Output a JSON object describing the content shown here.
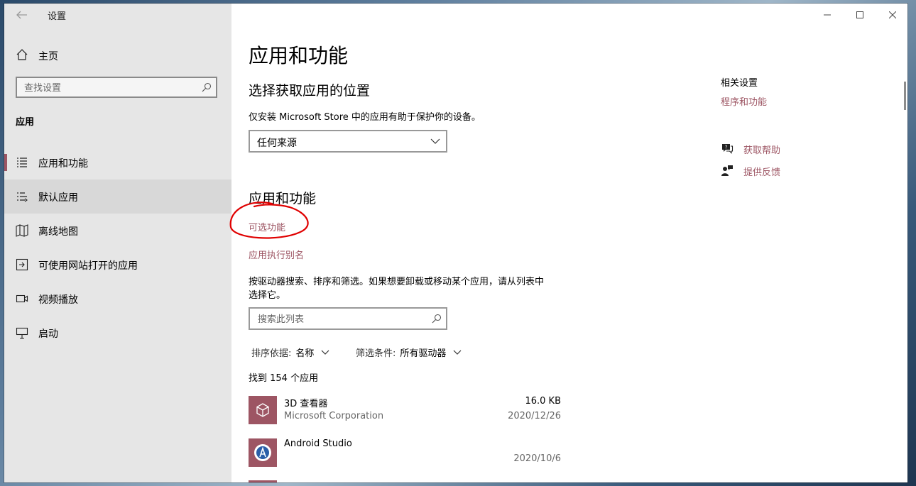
{
  "window": {
    "title": "设置",
    "controls": [
      "minimize-icon",
      "maximize-icon",
      "close-icon"
    ]
  },
  "nav": {
    "home_label": "主页",
    "search_placeholder": "查找设置",
    "section_header": "应用",
    "items": [
      {
        "label": "应用和功能",
        "icon": "apps-list-icon",
        "selected": false,
        "active": true
      },
      {
        "label": "默认应用",
        "icon": "default-apps-icon",
        "selected": true,
        "active": false
      },
      {
        "label": "离线地图",
        "icon": "map-icon",
        "selected": false,
        "active": false
      },
      {
        "label": "可使用网站打开的应用",
        "icon": "open-in-app-icon",
        "selected": false,
        "active": false
      },
      {
        "label": "视频播放",
        "icon": "video-icon",
        "selected": false,
        "active": false
      },
      {
        "label": "启动",
        "icon": "startup-icon",
        "selected": false,
        "active": false
      }
    ]
  },
  "main": {
    "page_title": "应用和功能",
    "install_section": {
      "heading": "选择获取应用的位置",
      "description": "仅安装 Microsoft Store 中的应用有助于保护你的设备。",
      "dropdown_value": "任何来源"
    },
    "apps_section": {
      "heading": "应用和功能",
      "link_optional": "可选功能",
      "link_alias": "应用执行别名",
      "description_line1": "按驱动器搜索、排序和筛选。如果想要卸载或移动某个应用，请从列表中",
      "description_line2": "选择它。",
      "search_placeholder": "搜索此列表",
      "sort_label": "排序依据:",
      "sort_value": "名称",
      "filter_label": "筛选条件:",
      "filter_value": "所有驱动器",
      "count_text": "找到 154 个应用"
    },
    "apps": [
      {
        "name": "3D 查看器",
        "publisher": "Microsoft Corporation",
        "size": "16.0 KB",
        "date": "2020/12/26",
        "icon": "3d-viewer-icon"
      },
      {
        "name": "Android Studio",
        "publisher": "",
        "size": "",
        "date": "2020/10/6",
        "icon": "android-studio-icon"
      }
    ]
  },
  "related": {
    "heading": "相关设置",
    "link": "程序和功能",
    "help_label": "获取帮助",
    "feedback_label": "提供反馈"
  },
  "colors": {
    "accent": "#9d5563",
    "nav_bg": "#e6e6e6",
    "annotation": "#e00000"
  }
}
